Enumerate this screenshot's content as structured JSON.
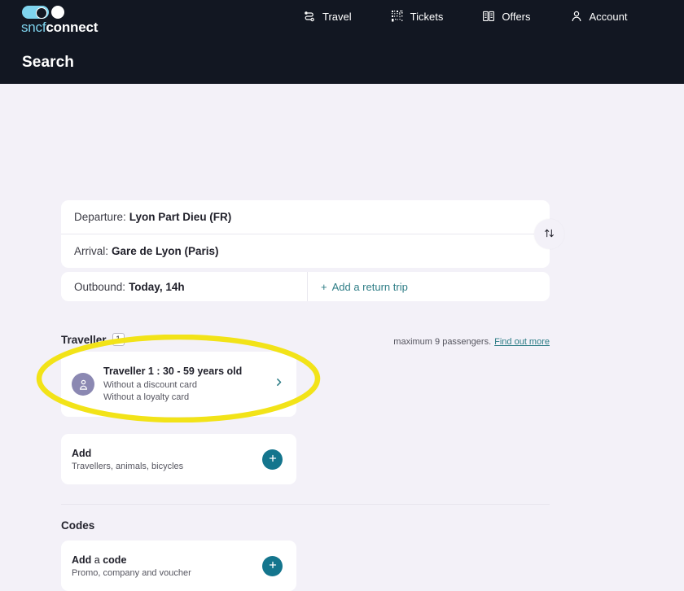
{
  "header": {
    "brand": {
      "part1": "sncf",
      "part2": "connect",
      "icon": "toggle-logo"
    },
    "nav": [
      {
        "label": "Travel",
        "icon": "route-icon"
      },
      {
        "label": "Tickets",
        "icon": "qr-code-icon"
      },
      {
        "label": "Offers",
        "icon": "book-icon"
      },
      {
        "label": "Account",
        "icon": "person-icon"
      }
    ],
    "page_title": "Search"
  },
  "search_form": {
    "departure_label": "Departure:",
    "departure_value": "Lyon Part Dieu (FR)",
    "arrival_label": "Arrival:",
    "arrival_value": "Gare de Lyon (Paris)",
    "swap_icon": "swap-vertical-icon",
    "outbound_label": "Outbound:",
    "outbound_value": "Today, 14h",
    "add_return_label": "Add a return trip",
    "add_return_plus": "+"
  },
  "traveller_section": {
    "heading": "Traveller",
    "count": "1",
    "max_note": "maximum 9 passengers.",
    "find_out_more": "Find out more",
    "traveller_card": {
      "avatar_icon": "person-avatar-icon",
      "title": "Traveller 1 : 30 - 59 years old",
      "line1": "Without a discount card",
      "line2": "Without a loyalty card",
      "chevron_icon": "chevron-right-icon"
    },
    "add_card": {
      "title": "Add",
      "subtitle": "Travellers, animals, bicycles",
      "plus_icon": "plus-icon"
    }
  },
  "codes_section": {
    "heading": "Codes",
    "card": {
      "title_bold1": "Add",
      "title_regular": " a ",
      "title_bold2": "code",
      "subtitle": "Promo, company and voucher",
      "plus_icon": "plus-icon"
    }
  },
  "annotation": {
    "type": "ellipse-highlight",
    "color": "#f2e318",
    "target": "add-card"
  },
  "colors": {
    "header_bg": "#121722",
    "page_bg": "#f3f1f8",
    "brand_blue": "#7fd4ee",
    "teal": "#14758d",
    "link_teal": "#2e7d86",
    "avatar_purple": "#8b88b2",
    "annotation_yellow": "#f2e318"
  }
}
